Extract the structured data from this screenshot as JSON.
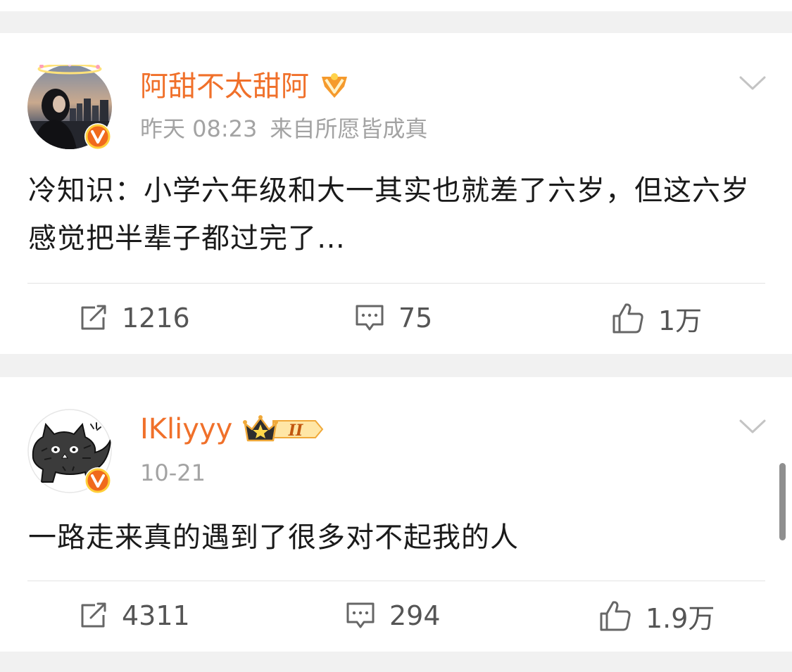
{
  "posts": [
    {
      "user_name": "阿甜不太甜阿",
      "time": "昨天 08:23",
      "source": "来自所愿皆成真",
      "text": "冷知识：小学六年级和大一其实也就差了六岁，但这六岁感觉把半辈子都过完了…",
      "reposts": "1216",
      "comments": "75",
      "likes": "1万",
      "avatar_icon": "avatar-photo",
      "name_badge_icon": "fan-badge-icon"
    },
    {
      "user_name": "IKliyyy",
      "time": "10-21",
      "source": "",
      "text": "一路走来真的遇到了很多对不起我的人",
      "reposts": "4311",
      "comments": "294",
      "likes": "1.9万",
      "avatar_icon": "cat-avatar",
      "name_badge_icon": "crown-level-badge-icon",
      "level": "II"
    }
  ],
  "colors": {
    "username": "#f0702a",
    "meta": "#a3a3a3",
    "text": "#1a1a1a",
    "action": "#555555",
    "verified_badge": "#f06a1c",
    "background": "#f1f1f1"
  }
}
